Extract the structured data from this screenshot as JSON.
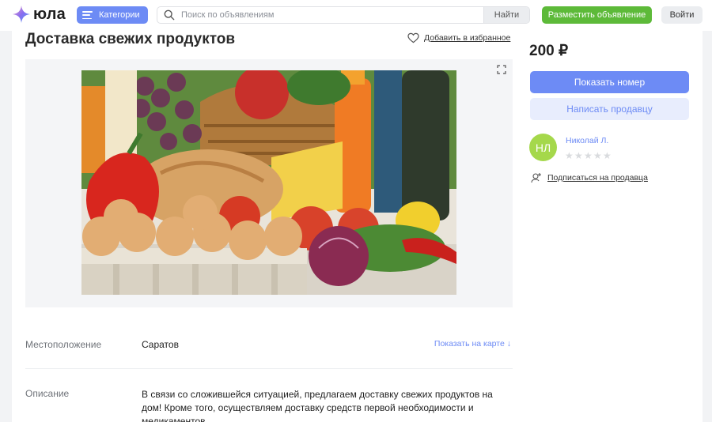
{
  "header": {
    "logo_text": "юла",
    "categories_label": "Категории",
    "search_placeholder": "Поиск по объявлениям",
    "search_button": "Найти",
    "post_button": "Разместить объявление",
    "login_button": "Войти"
  },
  "listing": {
    "title": "Доставка свежих продуктов",
    "favorite_label": "Добавить в избранное",
    "location_label": "Местоположение",
    "location_value": "Саратов",
    "map_link": "Показать на карте ↓",
    "description_label": "Описание",
    "description_text": "В связи со сложившейся ситуацией, предлагаем доставку свежих продуктов на дом! Кроме того, осуществляем доставку средств первой необходимости и медикаментов."
  },
  "sidebar": {
    "price": "200 ₽",
    "show_phone": "Показать номер",
    "write_seller": "Написать продавцу",
    "seller_initials": "НЛ",
    "seller_name": "Николай Л.",
    "rating": 0,
    "rating_max": 5,
    "subscribe_label": "Подписаться на продавца"
  },
  "colors": {
    "accent": "#6d8bf5",
    "post_green": "#5dba39",
    "avatar_green": "#a5d84b"
  },
  "icons": [
    "logo-star-icon",
    "burger-menu-icon",
    "search-icon",
    "heart-icon",
    "expand-icon",
    "subscribe-user-icon",
    "star-icon"
  ]
}
